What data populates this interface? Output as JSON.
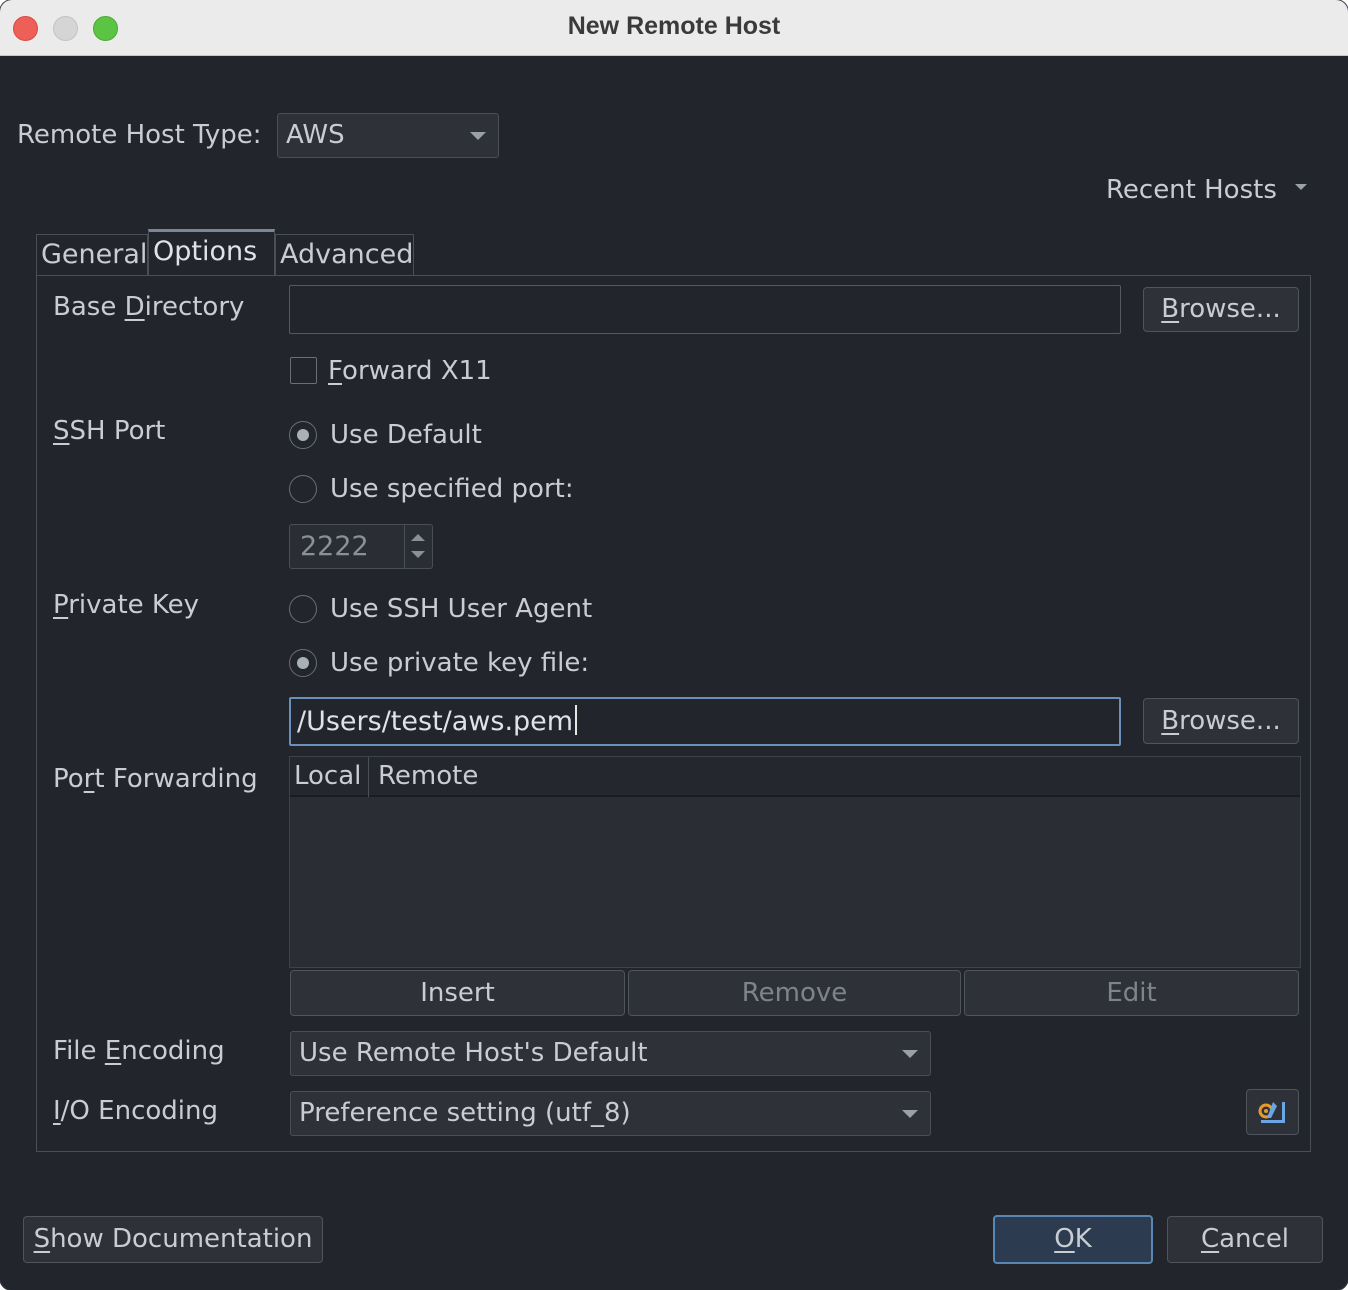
{
  "window": {
    "title": "New Remote Host"
  },
  "host_type": {
    "label": "Remote Host Type:",
    "value": "AWS"
  },
  "recent_hosts": {
    "label": "Recent Hosts"
  },
  "tabs": [
    {
      "label": "General",
      "active": false
    },
    {
      "label": "Options",
      "active": true
    },
    {
      "label": "Advanced",
      "active": false
    }
  ],
  "options": {
    "base_directory": {
      "label_pre": "Base ",
      "label_mn": "D",
      "label_post": "irectory",
      "value": "",
      "browse_mn": "B",
      "browse_rest": "rowse..."
    },
    "forward_x11": {
      "label_mn": "F",
      "label_rest": "orward X11",
      "checked": false
    },
    "ssh_port": {
      "label_mn": "S",
      "label_rest": "SH Port",
      "use_default": "Use Default",
      "use_specified": "Use specified port:",
      "port_value": "2222"
    },
    "private_key": {
      "label_mn": "P",
      "label_rest": "rivate Key",
      "use_agent": "Use SSH User Agent",
      "use_file": "Use private key file:",
      "file_value": "/Users/test/aws.pem",
      "browse_mn": "B",
      "browse_rest": "rowse..."
    },
    "port_forwarding": {
      "label_pre": "Po",
      "label_mn": "r",
      "label_post": "t Forwarding",
      "columns": [
        "Local",
        "Remote"
      ],
      "rows": [],
      "insert": "Insert",
      "remove": "Remove",
      "edit": "Edit"
    },
    "file_encoding": {
      "label_pre": "File ",
      "label_mn": "E",
      "label_post": "ncoding",
      "value": "Use Remote Host's Default"
    },
    "io_encoding": {
      "label_mn": "I",
      "label_rest": "/O Encoding",
      "value": "Preference setting (utf_8)"
    }
  },
  "footer": {
    "show_doc_mn": "S",
    "show_doc_rest": "how Documentation",
    "ok_mn": "O",
    "ok_rest": "K",
    "cancel_mn": "C",
    "cancel_rest": "ancel"
  },
  "colors": {
    "background": "#22252b",
    "accent": "#5a86b6",
    "text": "#c9cdd3"
  }
}
